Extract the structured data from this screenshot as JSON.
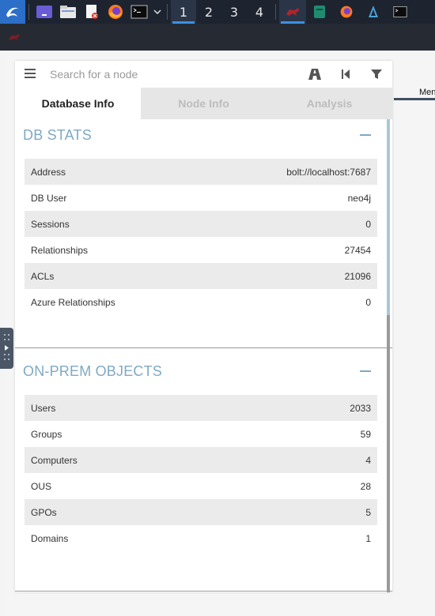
{
  "taskbar": {
    "workspaces": [
      "1",
      "2",
      "3",
      "4"
    ],
    "active_workspace": 0,
    "colors": {
      "bar": "#1d2430",
      "accent": "#3d8fe6"
    }
  },
  "window": {
    "graph_label": "Men"
  },
  "search": {
    "placeholder": "Search for a node"
  },
  "tabs": [
    {
      "label": "Database Info",
      "active": true
    },
    {
      "label": "Node Info",
      "active": false
    },
    {
      "label": "Analysis",
      "active": false
    }
  ],
  "db_stats": {
    "title": "DB STATS",
    "rows": [
      {
        "label": "Address",
        "value": "bolt://localhost:7687"
      },
      {
        "label": "DB User",
        "value": "neo4j"
      },
      {
        "label": "Sessions",
        "value": "0"
      },
      {
        "label": "Relationships",
        "value": "27454"
      },
      {
        "label": "ACLs",
        "value": "21096"
      },
      {
        "label": "Azure Relationships",
        "value": "0"
      }
    ]
  },
  "on_prem": {
    "title": "ON-PREM OBJECTS",
    "rows": [
      {
        "label": "Users",
        "value": "2033"
      },
      {
        "label": "Groups",
        "value": "59"
      },
      {
        "label": "Computers",
        "value": "4"
      },
      {
        "label": "OUS",
        "value": "28"
      },
      {
        "label": "GPOs",
        "value": "5"
      },
      {
        "label": "Domains",
        "value": "1"
      }
    ]
  },
  "colors": {
    "section_title": "#7fa9c3",
    "row_stripe": "#ebebeb",
    "tab_inactive_bg": "#e6e6e6"
  }
}
